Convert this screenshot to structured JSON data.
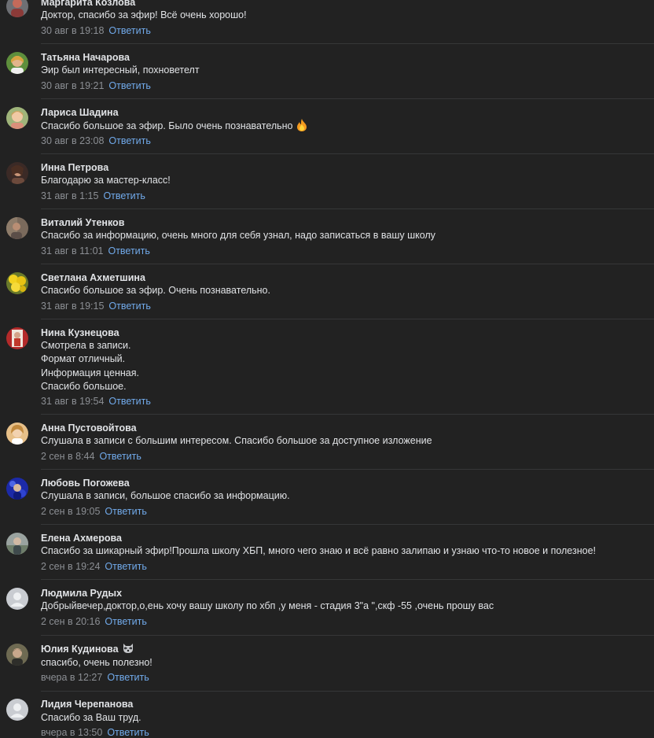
{
  "reply_label": "Ответить",
  "colors": {
    "background": "#222222",
    "text": "#e1e3e6",
    "secondary": "#8c8f94",
    "link": "#71aaeb",
    "divider": "#363738"
  },
  "comments": [
    {
      "author": "Маргарита Козлова",
      "lines": [
        "Доктор, спасибо за эфир! Всё очень хорошо!"
      ],
      "date": "30 авг в 19:18"
    },
    {
      "author": "Татьяна Начарова",
      "lines": [
        "Эир был интересный, похноветелт"
      ],
      "date": "30 авг в 19:21"
    },
    {
      "author": "Лариса Шадина",
      "lines": [
        "Спасибо большое за эфир. Было очень познавательно"
      ],
      "emoji": "fire-icon",
      "date": "30 авг в 23:08"
    },
    {
      "author": "Инна Петрова",
      "lines": [
        "Благодарю за мастер-класс!"
      ],
      "date": "31 авг в 1:15"
    },
    {
      "author": "Виталий Утенков",
      "lines": [
        "Спасибо за информацию, очень много для себя узнал, надо записаться в вашу школу"
      ],
      "date": "31 авг в 11:01"
    },
    {
      "author": "Светлана Ахметшина",
      "lines": [
        "Спасибо большое за эфир. Очень познавательно."
      ],
      "date": "31 авг в 19:15"
    },
    {
      "author": "Нина Кузнецова",
      "lines": [
        "Смотрела в записи.",
        "Формат отличный.",
        "Информация ценная.",
        "Спасибо большое."
      ],
      "date": "31 авг в 19:54"
    },
    {
      "author": "Анна Пустовойтова",
      "lines": [
        "Слушала в записи с большим интересом. Спасибо большое за доступное изложение"
      ],
      "date": "2 сен в 8:44"
    },
    {
      "author": "Любовь Погожева",
      "lines": [
        "Слушала в записи, большое спасибо за информацию."
      ],
      "date": "2 сен в 19:05"
    },
    {
      "author": "Елена Ахмерова",
      "lines": [
        "Спасибо за шикарный эфир!Прошла школу ХБП, много чего знаю и всё равно залипаю и узнаю что-то новое и полезное!"
      ],
      "date": "2 сен в 19:24"
    },
    {
      "author": "Людмила Рудых",
      "lines": [
        "Добрыйвечер,доктор,о,ень хочу вашу школу по хбп ,у меня - стадия 3\"а \",скф -55 ,очень прошу вас"
      ],
      "date": "2 сен в 20:16"
    },
    {
      "author": "Юлия Кудинова",
      "author_badge": "raccoon-icon",
      "lines": [
        "спасибо, очень полезно!"
      ],
      "date": "вчера в 12:27"
    },
    {
      "author": "Лидия Черепанова",
      "lines": [
        "Спасибо за Ваш труд."
      ],
      "date": "вчера в 13:50"
    }
  ]
}
